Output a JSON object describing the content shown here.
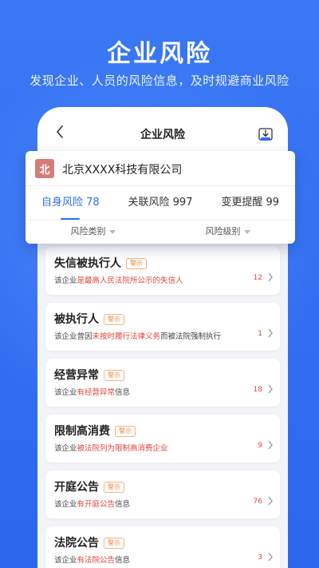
{
  "banner": {
    "title": "企业风险",
    "subtitle": "发现企业、人员的风险信息，及时规避商业风险"
  },
  "navbar": {
    "title": "企业风险",
    "back_icon": "chevron-left-icon",
    "download_icon": "download-icon"
  },
  "company": {
    "avatar_char": "北",
    "avatar_color": "#d77a7a",
    "name": "北京XXXX科技有限公司"
  },
  "tabs": [
    {
      "label": "自身风险 78",
      "active": true
    },
    {
      "label": "关联风险 997",
      "active": false
    },
    {
      "label": "变更提醒 99",
      "active": false
    }
  ],
  "filters": [
    {
      "label": "风险类别"
    },
    {
      "label": "风险级别"
    }
  ],
  "risks": [
    {
      "title": "失信被执行人",
      "badge": "警示",
      "desc_pre": "该企业",
      "desc_hl": "是最高人民法院所公示的失信人",
      "desc_post": "",
      "count": "12"
    },
    {
      "title": "被执行人",
      "badge": "警示",
      "desc_pre": "该企业曾因",
      "desc_hl": "未按时履行法律义务",
      "desc_post": "而被法院强制执行",
      "count": "1"
    },
    {
      "title": "经营异常",
      "badge": "警示",
      "desc_pre": "该企业",
      "desc_hl": "有经营异常",
      "desc_post": "信息",
      "count": "18"
    },
    {
      "title": "限制高消费",
      "badge": "警示",
      "desc_pre": "该企业",
      "desc_hl": "被法院列为限制高消费企业",
      "desc_post": "",
      "count": "9"
    },
    {
      "title": "开庭公告",
      "badge": "警示",
      "desc_pre": "该企业",
      "desc_hl": "有开庭公告",
      "desc_post": "信息",
      "count": "76"
    },
    {
      "title": "法院公告",
      "badge": "警示",
      "desc_pre": "该企业",
      "desc_hl": "有法院公告",
      "desc_post": "信息",
      "count": "3"
    }
  ],
  "colors": {
    "brand": "#2e6ff0",
    "highlight": "#e2463b",
    "badge": "#f08a3c"
  }
}
